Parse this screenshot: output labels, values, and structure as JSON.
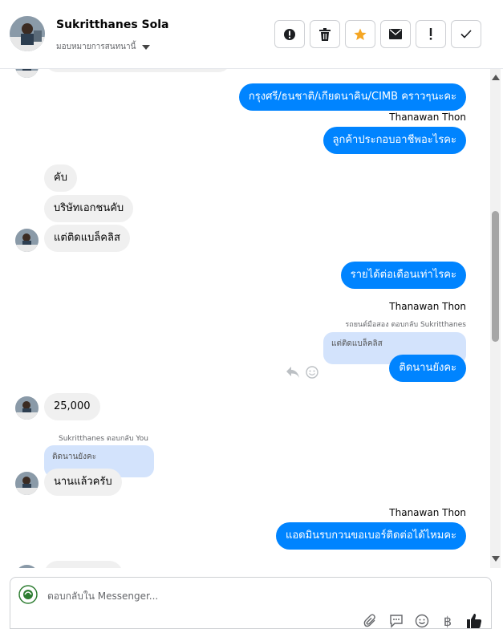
{
  "header": {
    "contact_name": "Sukritthanes Sola",
    "assign_label": "มอบหมายการสนทนานี้",
    "actions": [
      {
        "name": "report-button",
        "icon": "alert-circle-icon"
      },
      {
        "name": "delete-button",
        "icon": "trash-icon"
      },
      {
        "name": "star-button",
        "icon": "star-icon"
      },
      {
        "name": "mark-unread-button",
        "icon": "envelope-icon"
      },
      {
        "name": "flag-important-button",
        "icon": "exclamation-icon"
      },
      {
        "name": "mark-done-button",
        "icon": "check-icon"
      }
    ],
    "star_color": "#f5a623"
  },
  "messages": {
    "m1": "กรุงศรี/ธนชาติ/เกียดนาคิน/CIMB คราวๆนะคะ",
    "sender1": "Thanawan Thon",
    "m2": "ลูกค้าประกอบอาชีพอะไรคะ",
    "m3": "คับ",
    "m4": "บริษัทเอกชนคับ",
    "m5": "แต่ติดแบล็คลิส",
    "m6": "รายได้ต่อเดือนเท่าไรคะ",
    "sender2": "Thanawan Thon",
    "reply_meta2": "รถยนต์มือสอง ตอบกลับ Sukritthanes",
    "quote2": "แต่ติดแบล็คลิส",
    "m7": "ติดนานยังคะ",
    "m8": "25,000",
    "reply_meta3": "Sukritthanes ตอบกลับ You",
    "quote3": "ติดนานยังคะ",
    "m9": "นานแล้วครับ",
    "sender3": "Thanawan Thon",
    "m10": "แอดมินรบกวนขอเบอร์ติดต่อได้ไหมคะ"
  },
  "composer": {
    "placeholder": "ตอบกลับใน Messenger...",
    "tools": [
      "paperclip-icon",
      "chat-bubble-icon",
      "emoji-icon",
      "baht-icon",
      "thumbs-up-icon"
    ],
    "baht_symbol": "฿"
  },
  "colors": {
    "outgoing": "#0084ff",
    "incoming": "#f0f0f0",
    "quote": "#d3e3fc"
  }
}
